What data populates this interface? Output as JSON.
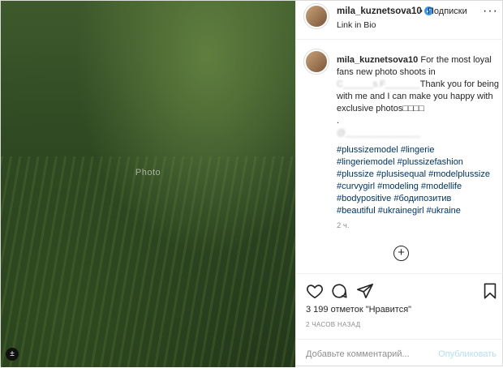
{
  "post": {
    "username": "mila_kuznetsova10",
    "verified_glyph": "✓",
    "follow_label": "Подписки",
    "separator": "•",
    "subtitle": "Link in Bio",
    "more_glyph": "···",
    "photo_note": "Photo"
  },
  "caption": {
    "username": "mila_kuznetsova10",
    "line1": "For the most loyal fans new photo shoots in",
    "obscured1": "C______s.F_______",
    "line2": "Thank you for being with me and I can make you happy with exclusive photos□□□□",
    "dot": ".",
    "obscured2": "@_______________",
    "hashtags": [
      "#plussizemodel #lingerie",
      "#lingeriemodel #plussizefashion",
      "#plussize #plusisequal #modelplussize",
      "#curvygirl #modeling #modellife",
      "#bodypositive #бодипозитив",
      "#beautiful #ukrainegirl #ukraine"
    ],
    "time": "2 ч."
  },
  "load_more_glyph": "+",
  "actions": {
    "likes": "3 199 отметок \"Нравится\"",
    "post_time": "2 ЧАСОВ НАЗАД"
  },
  "comment": {
    "placeholder": "Добавьте комментарий...",
    "publish_label": "Опубликовать"
  },
  "badge_glyph": "±",
  "icons": [
    "heart-icon",
    "comment-icon",
    "share-icon",
    "bookmark-icon",
    "verified-icon",
    "more-icon",
    "plus-circle-icon"
  ],
  "colors": {
    "link": "#003569",
    "verified": "#3897f0",
    "publish_disabled": "#b2dffc",
    "muted": "#8e8e8e"
  }
}
